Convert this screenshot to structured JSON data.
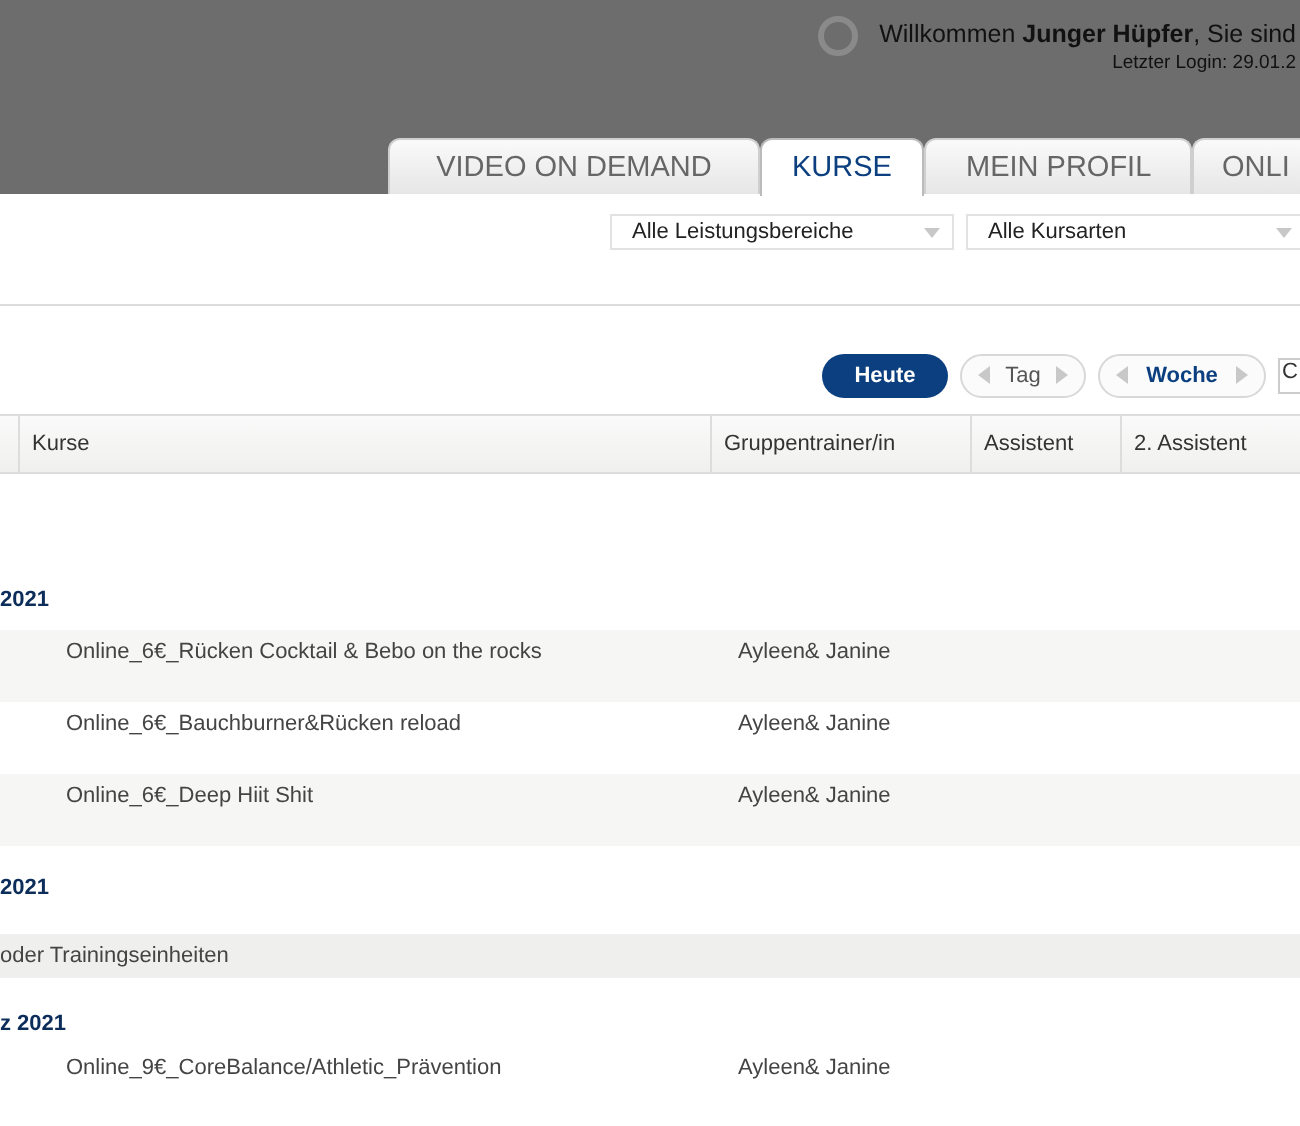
{
  "header": {
    "welcome": "Willkommen **Junger Hüpfer**, Sie sind",
    "last_login": "Letzter Login: 29.01.2"
  },
  "tabs": [
    {
      "label": "VIDEO ON DEMAND",
      "selected": false
    },
    {
      "label": "KURSE",
      "selected": true
    },
    {
      "label": "MEIN PROFIL",
      "selected": false
    },
    {
      "label": "ONLI",
      "selected": false
    }
  ],
  "filters": [
    {
      "value": "Alle Leistungsbereiche"
    },
    {
      "value": "Alle Kursarten"
    }
  ],
  "toolbar": {
    "today": "Heute",
    "day": "Tag",
    "week": "Woche",
    "date_field": "C"
  },
  "table": {
    "columns": [
      "Kurse",
      "Gruppentrainer/in",
      "Assistent",
      "2. Assistent"
    ],
    "rows": [
      {
        "kind": "date",
        "text": "2021"
      },
      {
        "kind": "course",
        "course": "Online_6€_Rücken Cocktail & Bebo on the rocks",
        "trainer": "Ayleen& Janine"
      },
      {
        "kind": "course",
        "course": "Online_6€_Bauchburner&Rücken reload",
        "trainer": "Ayleen& Janine"
      },
      {
        "kind": "course",
        "course": "Online_6€_Deep Hiit Shit",
        "trainer": "Ayleen& Janine"
      },
      {
        "kind": "date",
        "text": "2021"
      },
      {
        "kind": "note",
        "text": "oder Trainingseinheiten"
      },
      {
        "kind": "date",
        "text": "z 2021"
      },
      {
        "kind": "course",
        "course": "Online_9€_CoreBalance/Athletic_Prävention",
        "trainer": "Ayleen& Janine"
      }
    ]
  }
}
